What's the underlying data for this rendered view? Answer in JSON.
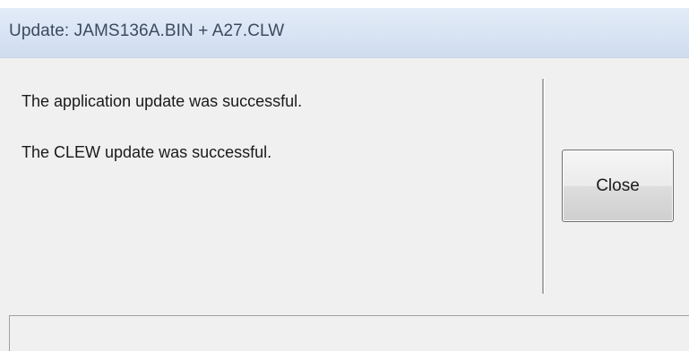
{
  "window": {
    "title": "Update: JAMS136A.BIN + A27.CLW"
  },
  "messages": [
    "The application update was successful.",
    "The CLEW update was successful."
  ],
  "buttons": {
    "close_label": "Close"
  },
  "colors": {
    "titlebar_bg": "#d8e4f3",
    "title_text": "#3c4a5e",
    "client_bg": "#f0f0f0"
  }
}
